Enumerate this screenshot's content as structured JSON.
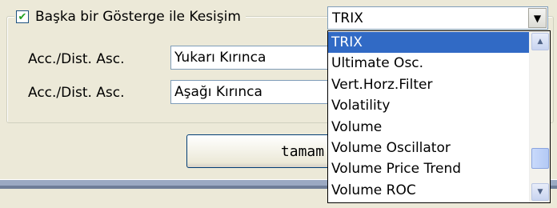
{
  "group": {
    "checkbox_checked": true,
    "check_mark": "✔",
    "legend": "Başka bir Gösterge ile Kesişim"
  },
  "rows": [
    {
      "label": "Acc./Dist. Asc.",
      "value": "Yukarı Kırınca"
    },
    {
      "label": "Acc./Dist. Asc.",
      "value": "Aşağı Kırınca"
    }
  ],
  "combo": {
    "value": "TRIX",
    "arrow_icon": "▼"
  },
  "dropdown": {
    "items": [
      "TRIX",
      "Ultimate Osc.",
      "Vert.Horz.Filter",
      "Volatility",
      "Volume",
      "Volume Oscillator",
      "Volume Price Trend",
      "Volume ROC"
    ],
    "selected_index": 0,
    "scroll_up_icon": "▲",
    "scroll_down_icon": "▼"
  },
  "ok_button": {
    "label": "tamam"
  },
  "colors": {
    "background": "#ece9d8",
    "selection": "#316ac5",
    "field_border": "#7f9db9"
  }
}
